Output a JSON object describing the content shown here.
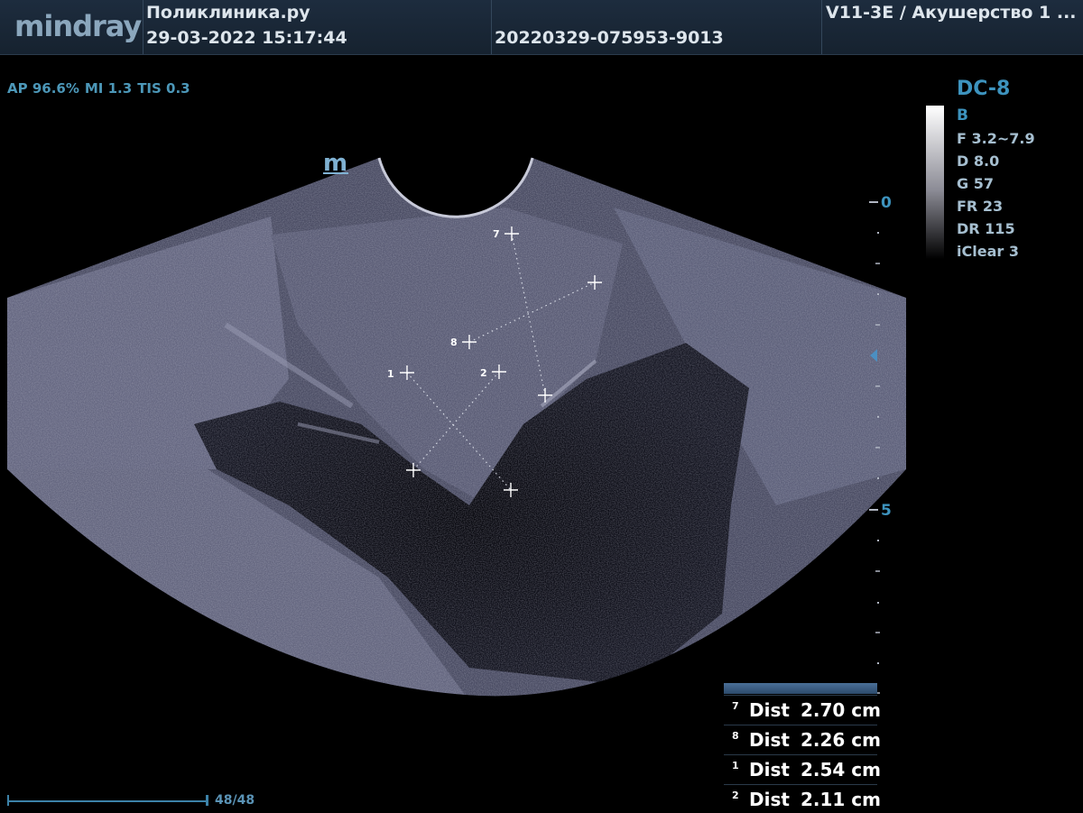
{
  "header": {
    "logo": "mindray",
    "clinic": "Поликлиника.ру",
    "datetime": "29-03-2022  15:17:44",
    "study_id": "20220329-075953-9013",
    "probe_preset": "V11-3E / Акушерство 1 ..."
  },
  "acoustic": {
    "ap": "AP 96.6%",
    "mi": "MI 1.3",
    "tis": "TIS 0.3"
  },
  "panel": {
    "preset": "DC-8",
    "mode": "B",
    "params": [
      "F 3.2~7.9",
      "D 8.0",
      "G 57",
      "FR 23",
      "DR 115",
      "iClear 3"
    ]
  },
  "orientation_marker": "m",
  "depth_scale": {
    "label_0": "0",
    "label_5": "5"
  },
  "calipers": [
    "7",
    "8",
    "1",
    "2"
  ],
  "cine": {
    "count": "48/48"
  },
  "measurements": [
    {
      "index": "7",
      "label": "Dist",
      "value": "2.70 cm"
    },
    {
      "index": "8",
      "label": "Dist",
      "value": "2.26 cm"
    },
    {
      "index": "1",
      "label": "Dist",
      "value": "2.54 cm"
    },
    {
      "index": "2",
      "label": "Dist",
      "value": "2.11 cm"
    }
  ]
}
